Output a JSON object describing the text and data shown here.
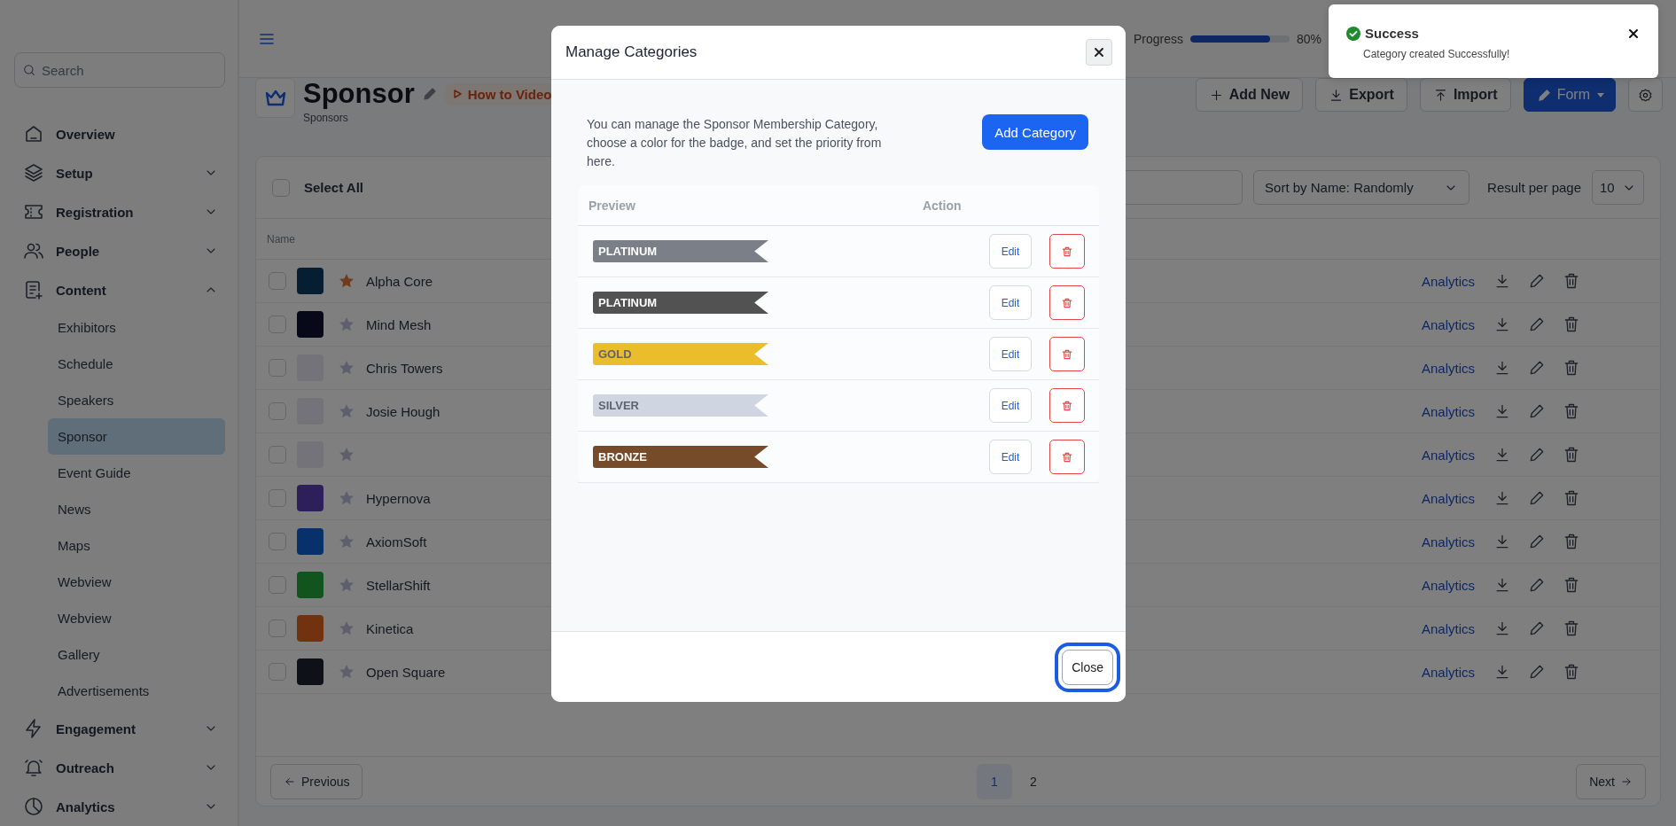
{
  "sidebar": {
    "search": {
      "placeholder": "Search"
    },
    "items": [
      {
        "label": "Overview",
        "selected": false
      },
      {
        "label": "Setup",
        "selected": false,
        "expanded": false
      },
      {
        "label": "Registration",
        "selected": false,
        "expanded": false
      },
      {
        "label": "People",
        "selected": false,
        "expanded": false
      },
      {
        "label": "Content",
        "selected": false,
        "expanded": true,
        "children": [
          {
            "label": "Exhibitors",
            "selected": false
          },
          {
            "label": "Schedule",
            "selected": false
          },
          {
            "label": "Speakers",
            "selected": false
          },
          {
            "label": "Sponsor",
            "selected": true
          },
          {
            "label": "Event Guide",
            "selected": false
          },
          {
            "label": "News",
            "selected": false
          },
          {
            "label": "Maps",
            "selected": false
          },
          {
            "label": "Webview",
            "selected": false
          },
          {
            "label": "Webview",
            "selected": false
          },
          {
            "label": "Gallery",
            "selected": false
          },
          {
            "label": "Advertisements",
            "selected": false
          }
        ]
      },
      {
        "label": "Engagement",
        "selected": false,
        "expanded": false
      },
      {
        "label": "Outreach",
        "selected": false,
        "expanded": false
      },
      {
        "label": "Analytics",
        "selected": false,
        "expanded": false
      }
    ]
  },
  "header": {
    "progress": {
      "label": "Progress",
      "level": 0.8,
      "reading": "80%"
    }
  },
  "page": {
    "title": "Sponsor",
    "subtitle": "Sponsors",
    "video_link": "How to Video",
    "actions": [
      {
        "label": "Add New",
        "kind": "outline"
      },
      {
        "label": "Export",
        "kind": "outline"
      },
      {
        "label": "Import",
        "kind": "outline"
      },
      {
        "label": "Form",
        "kind": "primary"
      },
      {
        "kind": "icon"
      }
    ]
  },
  "toolbar": {
    "select_all": {
      "label": "Select All",
      "checked": false
    },
    "sort": {
      "value": "Sort by Name: Randomly"
    },
    "per_page": {
      "label": "Result per page",
      "value": "10"
    }
  },
  "table": {
    "columns": [
      "Name"
    ],
    "rows": [
      {
        "checked": false,
        "featured": true,
        "name": "Alpha Core",
        "action": "Analytics"
      },
      {
        "checked": false,
        "featured": false,
        "name": "Mind Mesh",
        "action": "Analytics"
      },
      {
        "checked": false,
        "featured": false,
        "name": "Chris Towers",
        "action": "Analytics"
      },
      {
        "checked": false,
        "featured": false,
        "name": "Josie Hough",
        "action": "Analytics"
      },
      {
        "checked": false,
        "featured": false,
        "action": "Analytics"
      },
      {
        "checked": false,
        "featured": false,
        "name": "Hypernova",
        "action": "Analytics"
      },
      {
        "checked": false,
        "featured": false,
        "name": "AxiomSoft",
        "action": "Analytics"
      },
      {
        "checked": false,
        "featured": false,
        "name": "StellarShift",
        "action": "Analytics"
      },
      {
        "checked": false,
        "featured": false,
        "name": "Kinetica",
        "action": "Analytics"
      },
      {
        "checked": false,
        "featured": false,
        "name": "Open Square",
        "action": "Analytics"
      }
    ]
  },
  "pagination": {
    "previous": "Previous",
    "pages": [
      {
        "label": "1",
        "selected": true
      },
      {
        "label": "2",
        "selected": false
      }
    ],
    "next": "Next"
  },
  "modal": {
    "title": "Manage Categories",
    "description": "You can manage the Sponsor Membership Category, choose a color for the badge, and set the priority from here.",
    "add_button": "Add Category",
    "columns": [
      "Preview",
      "Action"
    ],
    "categories": [
      {
        "name": "PLATINUM",
        "color": "#7a7f88",
        "edit": "Edit"
      },
      {
        "name": "PLATINUM",
        "color": "#525252",
        "edit": "Edit"
      },
      {
        "name": "GOLD",
        "color": "#ebbd2a",
        "edit": "Edit"
      },
      {
        "name": "SILVER",
        "color": "#cfd6e1",
        "edit": "Edit"
      },
      {
        "name": "BRONZE",
        "color": "#764b2a",
        "edit": "Edit"
      }
    ],
    "close_button": {
      "label": "Close",
      "focused": true
    }
  },
  "toast": {
    "title": "Success",
    "message": "Category created Successfully!"
  }
}
